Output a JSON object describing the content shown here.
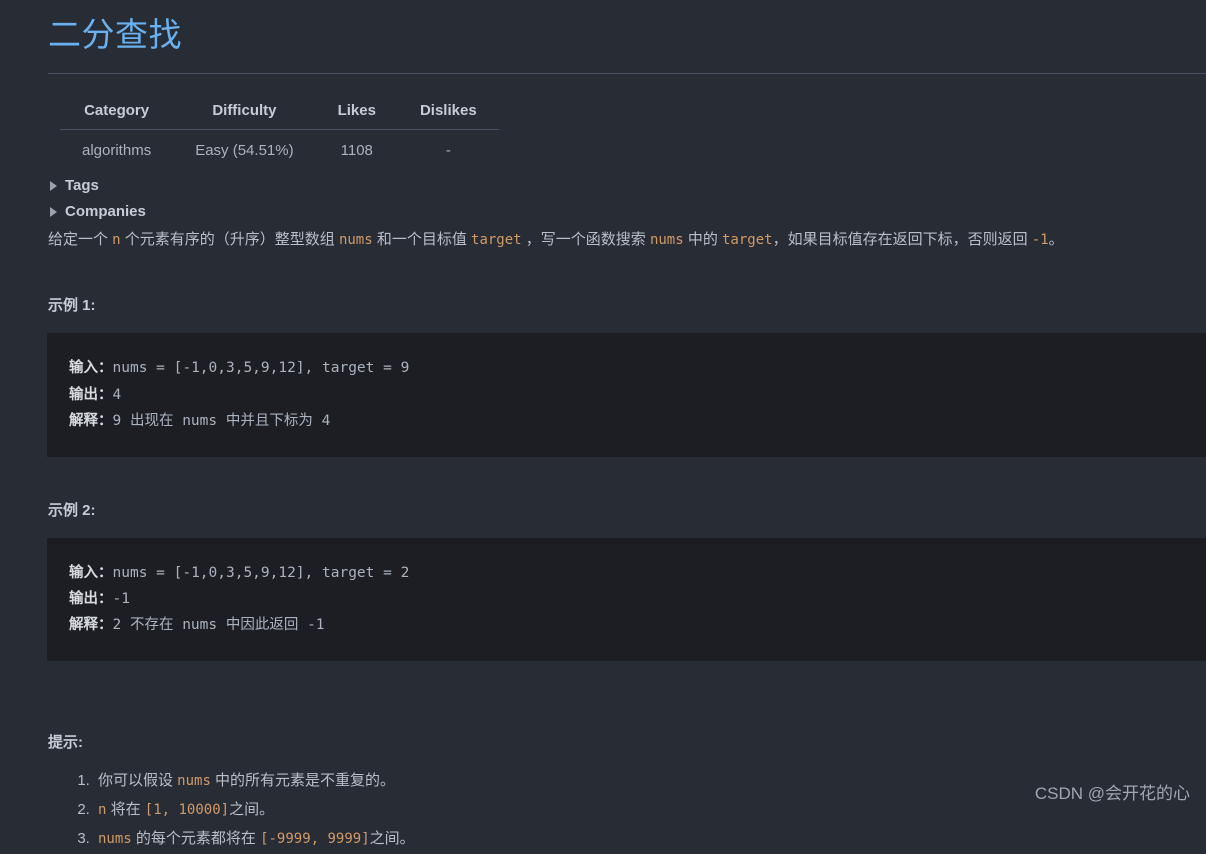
{
  "problem": {
    "title": "二分查找"
  },
  "meta": {
    "headers": [
      "Category",
      "Difficulty",
      "Likes",
      "Dislikes"
    ],
    "row": [
      "algorithms",
      "Easy (54.51%)",
      "1108",
      "-"
    ]
  },
  "collapsibles": [
    {
      "label": "Tags",
      "marker": "triangle-right-icon"
    },
    {
      "label": "Companies",
      "marker": "triangle-right-icon"
    }
  ],
  "description": {
    "seg1": "给定一个 ",
    "code1": "n",
    "seg2": " 个元素有序的（升序）整型数组 ",
    "code2": "nums",
    "seg3": " 和一个目标值 ",
    "code3": "target",
    "seg4": " ，写一个函数搜索 ",
    "code4": "nums",
    "seg5": " 中的 ",
    "code5": "target",
    "seg6": "，如果目标值存在返回下标，否则返回 ",
    "code6": "-1",
    "seg7": "。"
  },
  "examples": [
    {
      "heading": "示例 1:",
      "lines": [
        {
          "label": "输入：",
          "text": "nums = [-1,0,3,5,9,12], target = 9"
        },
        {
          "label": "输出：",
          "text": "4"
        },
        {
          "label": "解释：",
          "text": "9 出现在 nums 中并且下标为 4"
        }
      ]
    },
    {
      "heading": "示例 2:",
      "lines": [
        {
          "label": "输入：",
          "text": "nums = [-1,0,3,5,9,12], target = 2"
        },
        {
          "label": "输出：",
          "text": "-1"
        },
        {
          "label": "解释：",
          "text": "2 不存在 nums 中因此返回 -1"
        }
      ]
    }
  ],
  "hints": {
    "heading": "提示:",
    "items": [
      {
        "pre": "你可以假设 ",
        "code": "nums",
        "post": " 中的所有元素是不重复的。"
      },
      {
        "pre": "",
        "code": "n",
        "mid": " 将在 ",
        "code2": "[1, 10000]",
        "post": "之间。"
      },
      {
        "pre": "",
        "code": "nums",
        "mid": " 的每个元素都将在 ",
        "code2": "[-9999, 9999]",
        "post": "之间。"
      }
    ]
  },
  "watermark": "CSDN @会开花的心",
  "colors": {
    "background": "#282c34",
    "code_block_background": "#1c1e24",
    "title": "#69b1f0",
    "code_span": "#d19a66",
    "body_text": "#b8bfc9",
    "rule": "#4a5161"
  }
}
